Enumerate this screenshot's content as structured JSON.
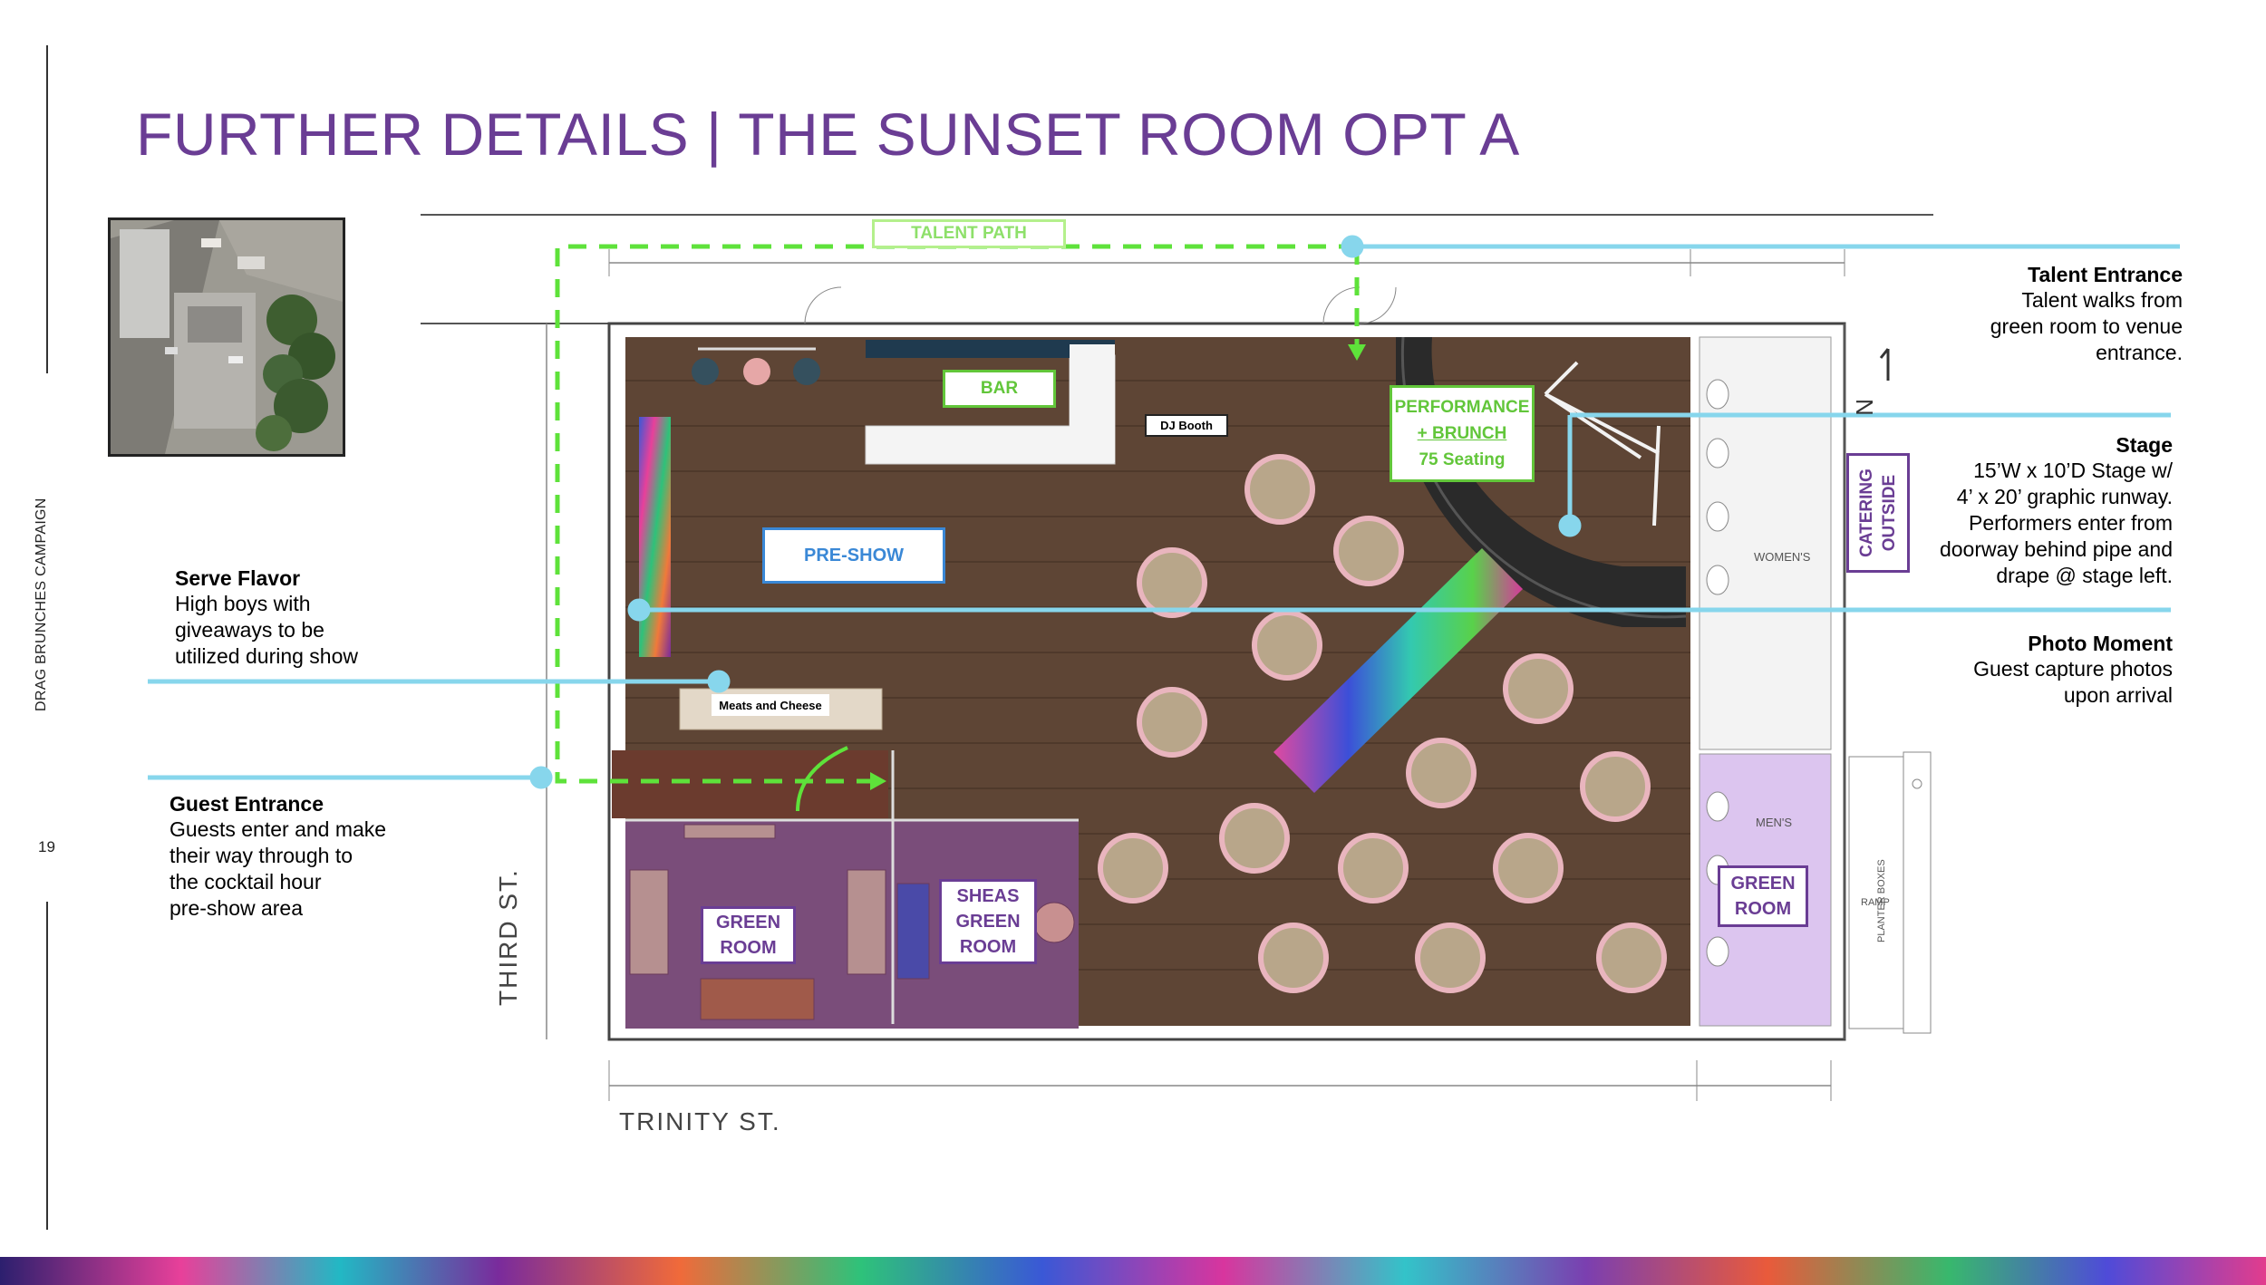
{
  "sidebar": {
    "campaign_label": "DRAG BRUNCHES CAMPAIGN",
    "page_number": "19"
  },
  "header": {
    "title": "FURTHER DETAILS | THE SUNSET ROOM OPT A"
  },
  "floor_plan": {
    "talent_path_label": "TALENT PATH",
    "bar_label": "BAR",
    "dj_booth_label": "DJ Booth",
    "preshow_label": "PRE-SHOW",
    "performance_line1": "PERFORMANCE",
    "performance_line2": "+ BRUNCH",
    "performance_line3": "75 Seating",
    "catering_line1": "CATERING",
    "catering_line2": "OUTSIDE",
    "meats_label": "Meats and Cheese",
    "green_room_left_line1": "GREEN",
    "green_room_left_line2": "ROOM",
    "sheas_line1": "SHEAS",
    "sheas_line2": "GREEN",
    "sheas_line3": "ROOM",
    "green_room_right_line1": "GREEN",
    "green_room_right_line2": "ROOM",
    "womens_label": "WOMEN'S",
    "mens_label": "MEN'S",
    "ramp_label": "RAMP",
    "planter_label": "PLANTER BOXES",
    "north_label": "N",
    "street_third": "THIRD ST.",
    "street_trinity": "TRINITY ST."
  },
  "callouts": {
    "talent_entrance": {
      "title": "Talent Entrance",
      "lines": [
        "Talent walks from",
        "green room to venue",
        "entrance."
      ]
    },
    "stage": {
      "title": "Stage",
      "lines": [
        "15’W x 10’D Stage w/",
        "4’ x 20’ graphic runway.",
        "Performers enter from",
        "doorway behind pipe and",
        "drape  @ stage left."
      ]
    },
    "photo_moment": {
      "title": "Photo Moment",
      "lines": [
        "Guest capture photos",
        "upon arrival"
      ]
    },
    "serve_flavor": {
      "title": "Serve Flavor",
      "lines": [
        "High boys with",
        "giveaways to be",
        "utilized during show"
      ]
    },
    "guest_entrance": {
      "title": "Guest Entrance",
      "lines": [
        "Guests enter and make",
        "their way through to",
        "the cocktail hour",
        "pre-show area"
      ]
    }
  },
  "colors": {
    "title_purple": "#6a3d94",
    "callout_line_blue": "#87d6ec",
    "path_green": "#5ee23a",
    "label_green": "#62c63a",
    "label_blue": "#3a88d6",
    "green_room_purple": "#6a3d94",
    "floor_wood": "#5a4232"
  }
}
